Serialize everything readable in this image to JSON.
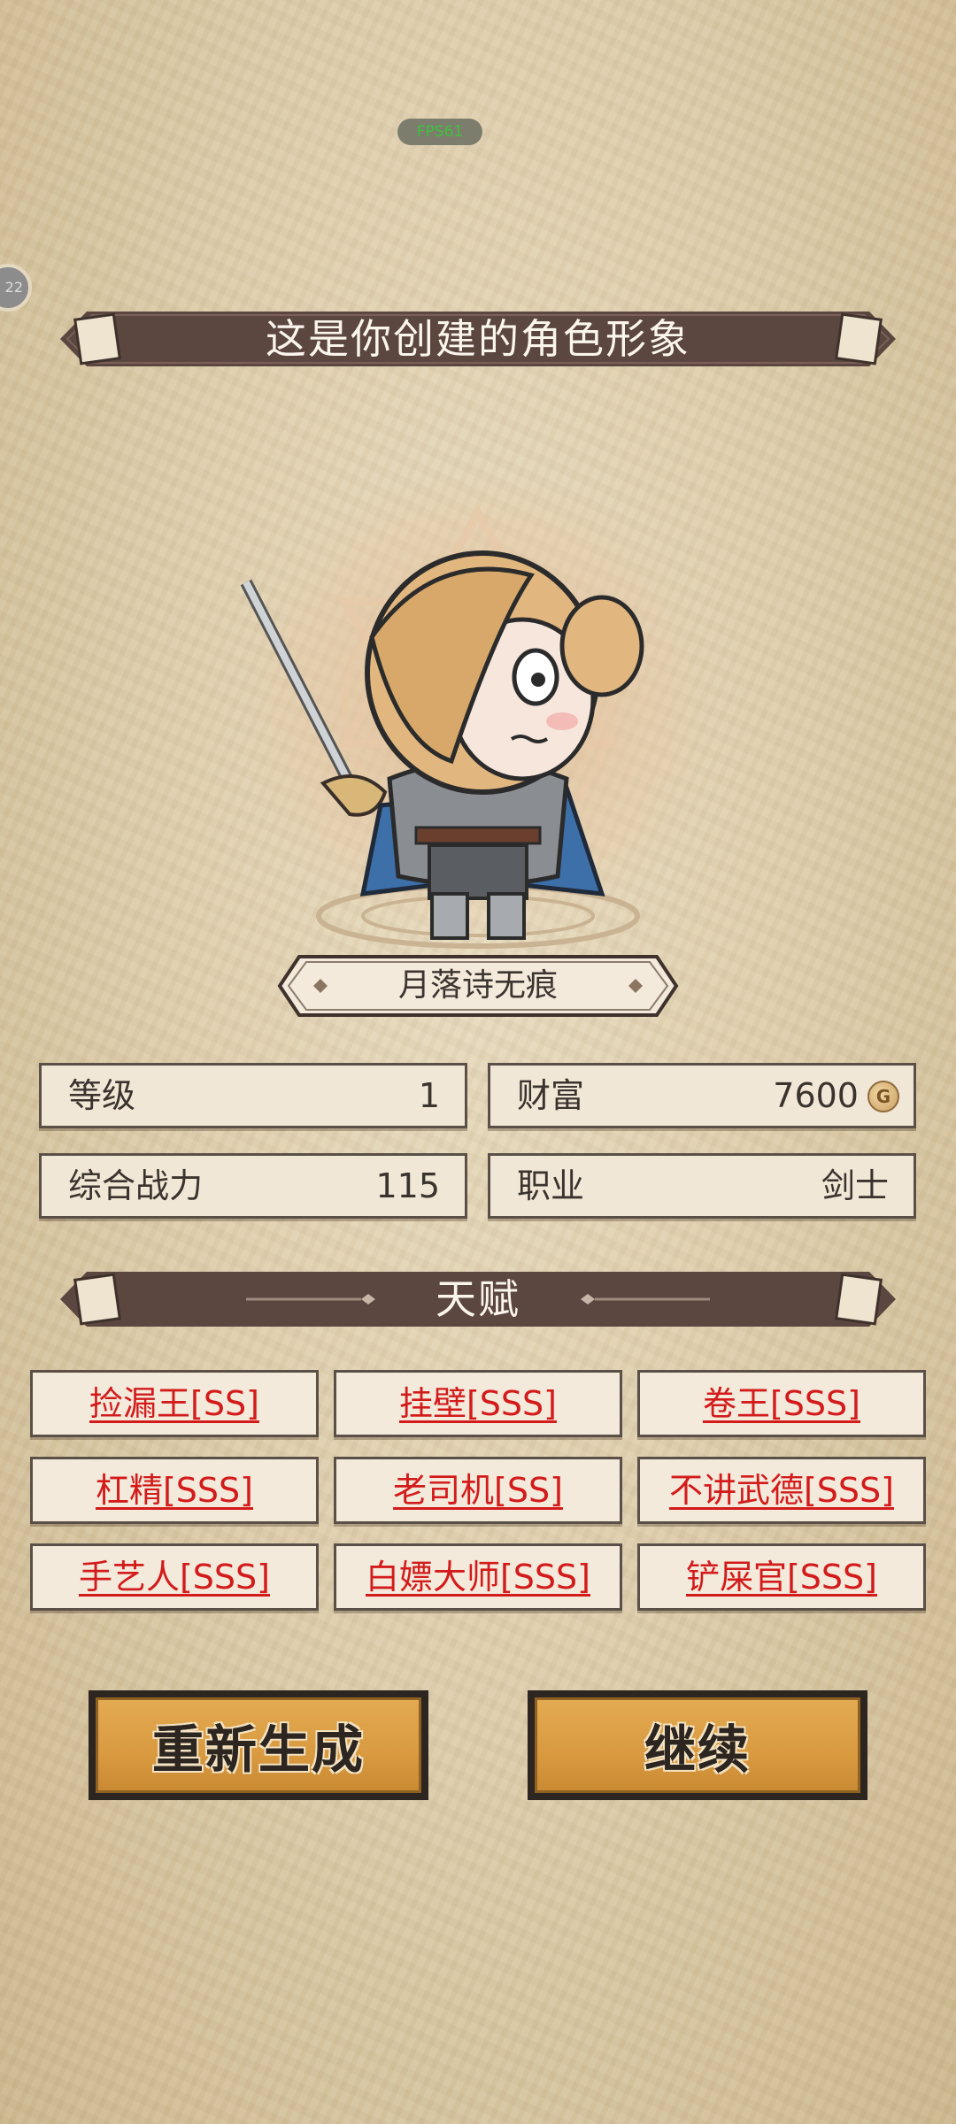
{
  "hud": {
    "fps": "FPS61",
    "side_badge": "22"
  },
  "header": {
    "title": "这是你创建的角色形象"
  },
  "character": {
    "name": "月落诗无痕",
    "icon": "chibi-swordsman-portrait"
  },
  "stats": {
    "level_label": "等级",
    "level_value": "1",
    "wealth_label": "财富",
    "wealth_value": "7600",
    "wealth_icon": "coin-icon",
    "power_label": "综合战力",
    "power_value": "115",
    "class_label": "职业",
    "class_value": "剑士"
  },
  "talents": {
    "title": "天赋",
    "items": [
      "捡漏王[SS]",
      "挂壁[SSS]",
      "卷王[SSS]",
      "杠精[SSS]",
      "老司机[SS]",
      "不讲武德[SSS]",
      "手艺人[SSS]",
      "白嫖大师[SSS]",
      "铲屎官[SSS]"
    ]
  },
  "actions": {
    "regenerate": "重新生成",
    "continue": "继续"
  },
  "colors": {
    "banner": "#5b4640",
    "talent_text": "#d31b1b",
    "button": "#d99a40"
  }
}
